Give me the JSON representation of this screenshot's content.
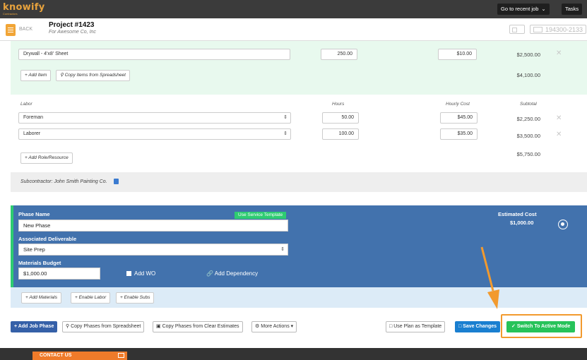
{
  "app": {
    "logo": "knowify",
    "logo_sub": "Contractors"
  },
  "topbar": {
    "recent_job": "Go to recent job",
    "tasks": "Tasks"
  },
  "project": {
    "back": "BACK",
    "title": "Project #1423",
    "client": "For Awesome Co, Inc",
    "job_number": "194300-2133"
  },
  "materials": {
    "row": {
      "name": "Drywall - 4'x8' Sheet",
      "qty": "250.00",
      "cost": "$10.00",
      "total": "$2,500.00"
    },
    "add_item": "+ Add Item",
    "copy_items": "Copy Items from Spreadsheet",
    "subtotal": "$4,100.00"
  },
  "labor": {
    "header": "Labor",
    "col_hours": "Hours",
    "col_cost": "Hourly Cost",
    "col_subtotal": "Subtotal",
    "rows": [
      {
        "role": "Foreman",
        "hours": "50.00",
        "cost": "$45.00",
        "subtotal": "$2,250.00"
      },
      {
        "role": "Laborer",
        "hours": "100.00",
        "cost": "$35.00",
        "subtotal": "$3,500.00"
      }
    ],
    "add_role": "+ Add Role/Resource",
    "total": "$5,750.00"
  },
  "subcontractor": {
    "label": "Subcontractor: John Smith Painting Co."
  },
  "phase": {
    "name_label": "Phase Name",
    "use_template": "Use Service Template",
    "name_value": "New Phase",
    "deliverable_label": "Associated Deliverable",
    "deliverable_value": "Site Prep",
    "budget_label": "Materials Budget",
    "budget_value": "$1,000.00",
    "add_wo": "Add WO",
    "add_dependency": "Add Dependency",
    "est_cost_label": "Estimated Cost",
    "est_cost_value": "$1,000.00",
    "add_materials": "+ Add Materials",
    "enable_labor": "+ Enable Labor",
    "enable_subs": "+ Enable Subs"
  },
  "toolbar": {
    "add_phase": "+ Add Job Phase",
    "copy_phases_sheet": "Copy Phases from Spreadsheet",
    "copy_phases_clear": "Copy Phases from Clear Estimates",
    "more_actions": "More Actions",
    "use_plan": "Use Plan as Template",
    "save_changes": "Save Changes",
    "switch_active": "Switch To Active Mode"
  },
  "footer": {
    "contact": "CONTACT US"
  },
  "colors": {
    "brand": "#e8a33d",
    "phase_blue": "#4272ad",
    "green": "#27c35a",
    "highlight": "#f29a2e"
  },
  "icons": [
    "back-icon",
    "lightbulb-icon",
    "select-arrow-icon",
    "close-icon",
    "document-icon",
    "link-icon",
    "radio-icon",
    "gear-icon",
    "check-icon",
    "mail-icon"
  ]
}
